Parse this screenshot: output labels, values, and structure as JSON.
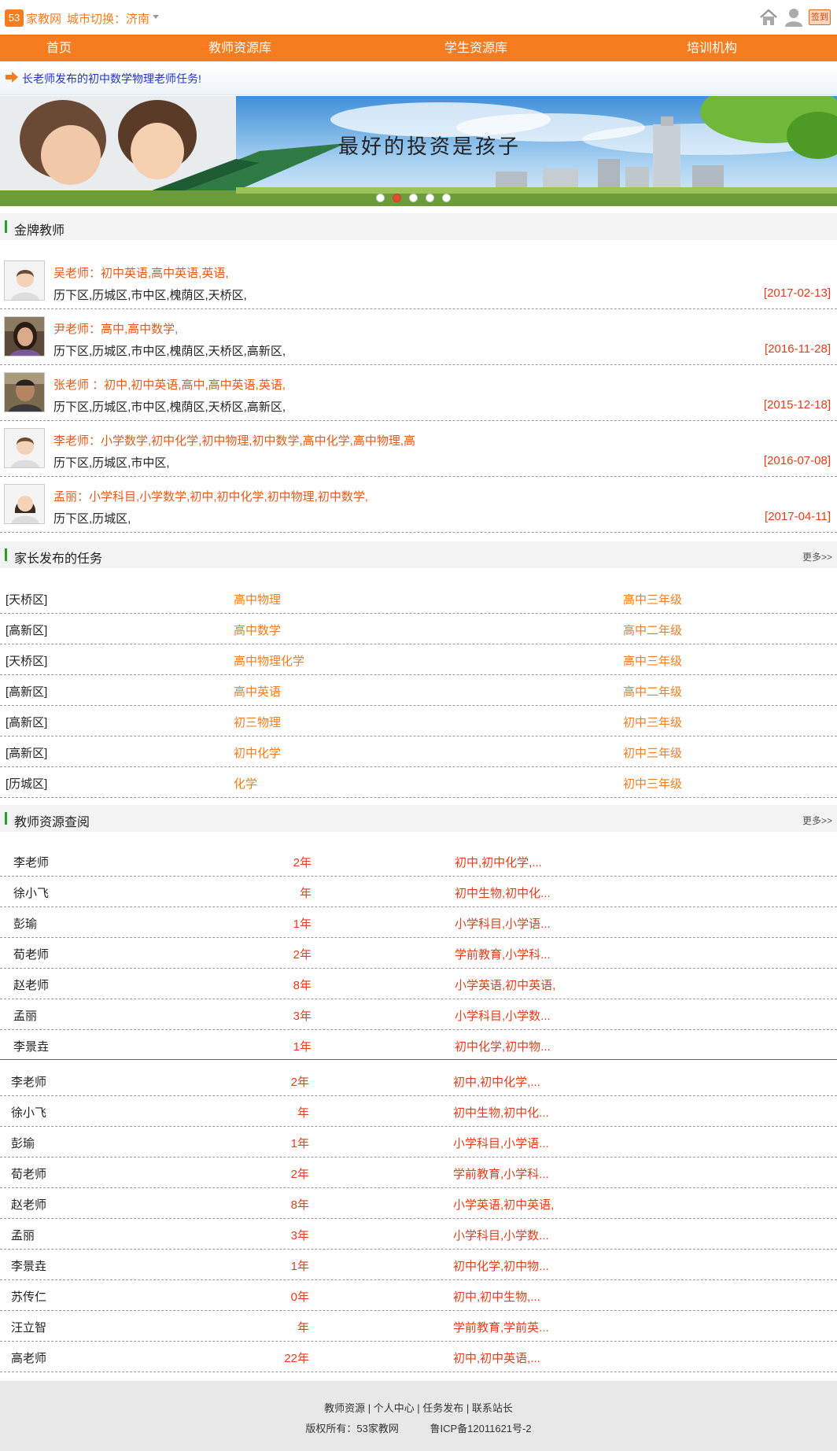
{
  "header": {
    "logo_text": "53",
    "site_name": "家教网",
    "city_switch": "城市切换：济南",
    "signin_label": "签到",
    "icons": [
      "home-icon",
      "user-icon"
    ]
  },
  "nav": [
    "首页",
    "教师资源库",
    "学生资源库",
    "培训机构"
  ],
  "notice": "长老师发布的初中数学物理老师任务!",
  "banner": {
    "slogan": "最好的投资是孩子",
    "slide_count": 5,
    "active_slide": 2
  },
  "gold_teachers": {
    "title": "金牌教师",
    "items": [
      {
        "line1": "吴老师：初中英语,高中英语,英语,",
        "line2": "历下区,历城区,市中区,槐荫区,天桥区,",
        "date": "[2017-02-13]",
        "avatar": "male"
      },
      {
        "line1": "尹老师：高中,高中数学,",
        "line2": "历下区,历城区,市中区,槐荫区,天桥区,高新区,",
        "date": "[2016-11-28]",
        "avatar": "photo-woman"
      },
      {
        "line1": "张老师 ：初中,初中英语,高中,高中英语,英语,",
        "line2": "历下区,历城区,市中区,槐荫区,天桥区,高新区,",
        "date": "[2015-12-18]",
        "avatar": "photo-man"
      },
      {
        "line1": "李老师：小学数学,初中化学,初中物理,初中数学,高中化学,高中物理,高",
        "line2": "历下区,历城区,市中区,",
        "date": "[2016-07-08]",
        "avatar": "male"
      },
      {
        "line1": "孟丽：小学科目,小学数学,初中,初中化学,初中物理,初中数学,",
        "line2": "历下区,历城区,",
        "date": "[2017-04-11]",
        "avatar": "female"
      }
    ]
  },
  "tasks": {
    "title": "家长发布的任务",
    "more": "更多>>",
    "items": [
      {
        "area": "[天桥区]",
        "subject": "高中物理",
        "grade": "高中三年级"
      },
      {
        "area": "[高新区]",
        "subject": "高中数学",
        "grade": "高中二年级"
      },
      {
        "area": "[天桥区]",
        "subject": "高中物理化学",
        "grade": "高中三年级"
      },
      {
        "area": "[高新区]",
        "subject": "高中英语",
        "grade": "高中二年级"
      },
      {
        "area": "[高新区]",
        "subject": "初三物理",
        "grade": "初中三年级"
      },
      {
        "area": "[高新区]",
        "subject": "初中化学",
        "grade": "初中三年级"
      },
      {
        "area": "[历城区]",
        "subject": "化学",
        "grade": "初中三年级"
      }
    ]
  },
  "resources": {
    "title": "教师资源查阅",
    "more": "更多>>",
    "group1": [
      {
        "name": "李老师",
        "years": "2年",
        "subjects": "初中,初中化学,..."
      },
      {
        "name": "徐小飞",
        "years": "年",
        "subjects": "初中生物,初中化..."
      },
      {
        "name": "彭瑜",
        "years": "1年",
        "subjects": "小学科目,小学语..."
      },
      {
        "name": "荀老师",
        "years": "2年",
        "subjects": "学前教育,小学科..."
      },
      {
        "name": "赵老师",
        "years": "8年",
        "subjects": "小学英语,初中英语,"
      },
      {
        "name": "孟丽",
        "years": "3年",
        "subjects": "小学科目,小学数..."
      },
      {
        "name": "李景垚",
        "years": "1年",
        "subjects": "初中化学,初中物..."
      }
    ],
    "group2": [
      {
        "name": "李老师",
        "years": "2年",
        "subjects": "初中,初中化学,..."
      },
      {
        "name": "徐小飞",
        "years": "年",
        "subjects": "初中生物,初中化..."
      },
      {
        "name": "彭瑜",
        "years": "1年",
        "subjects": "小学科目,小学语..."
      },
      {
        "name": "荀老师",
        "years": "2年",
        "subjects": "学前教育,小学科..."
      },
      {
        "name": "赵老师",
        "years": "8年",
        "subjects": "小学英语,初中英语,"
      },
      {
        "name": "孟丽",
        "years": "3年",
        "subjects": "小学科目,小学数..."
      },
      {
        "name": "李景垚",
        "years": "1年",
        "subjects": "初中化学,初中物..."
      },
      {
        "name": "苏传仁",
        "years": "0年",
        "subjects": "初中,初中生物,..."
      },
      {
        "name": "汪立智",
        "years": "年",
        "subjects": "学前教育,学前英..."
      },
      {
        "name": "高老师",
        "years": "22年",
        "subjects": "初中,初中英语,..."
      }
    ]
  },
  "footer": {
    "links": "教师资源 | 个人中心 | 任务发布 | 联系站长",
    "copyright": "版权所有：53家教网",
    "icp": "鲁ICP备12011621号-2"
  },
  "colors": {
    "brand_orange": "#f57c1f",
    "accent_red": "#e53c1b",
    "section_green": "#2a9d2a",
    "notice_blue": "#2233cc"
  }
}
